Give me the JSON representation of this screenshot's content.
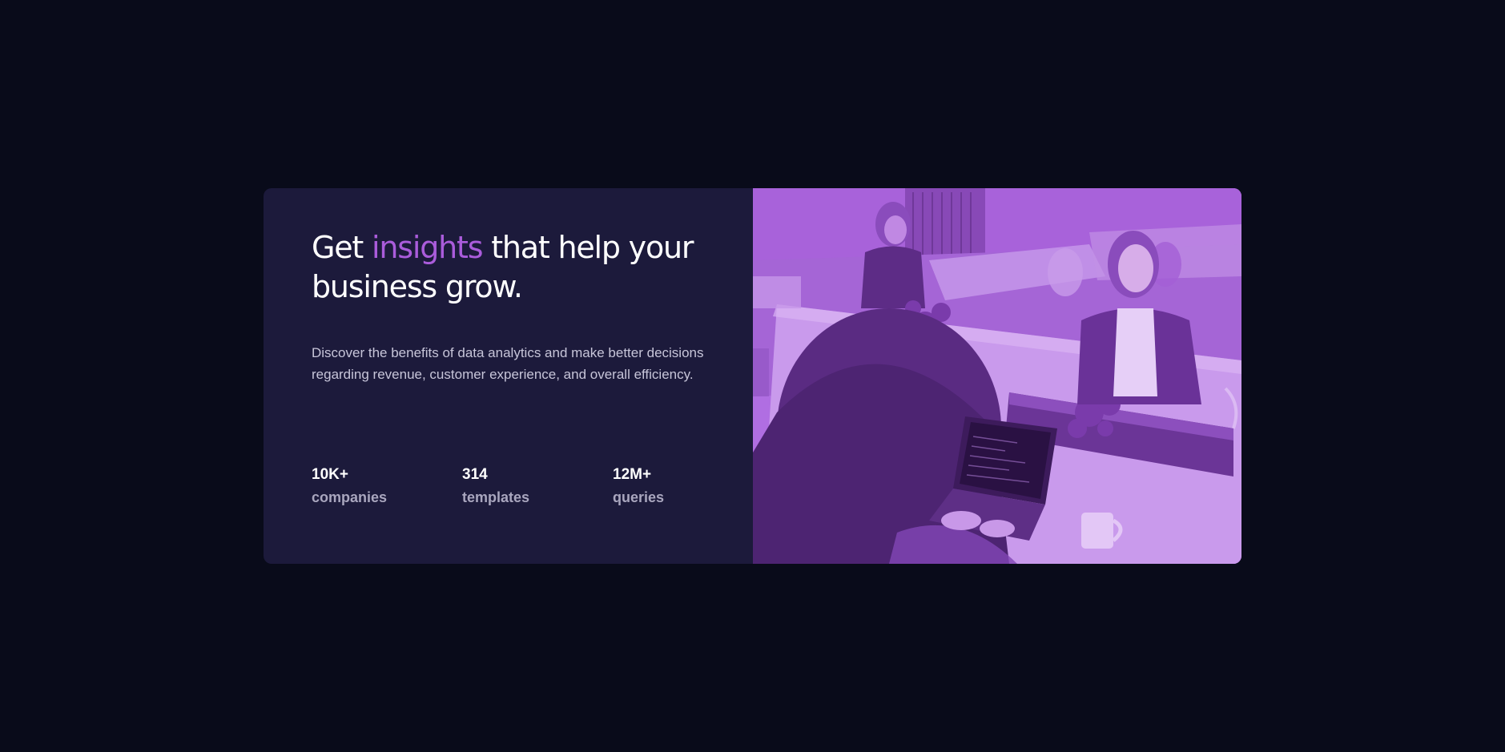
{
  "card": {
    "headline": {
      "before": "Get ",
      "accent": "insights",
      "after": " that help your business grow."
    },
    "description": "Discover the benefits of data analytics and make better decisions regarding revenue, customer experience, and overall efficiency.",
    "stats": [
      {
        "value": "10K+",
        "label": "companies"
      },
      {
        "value": "314",
        "label": "templates"
      },
      {
        "value": "12M+",
        "label": "queries"
      }
    ]
  },
  "colors": {
    "page_background": "#090b1a",
    "card_background": "#1c1a3b",
    "accent": "#aa5cdb",
    "image_overlay": "#b16ee3"
  },
  "image": {
    "icon": "office-photo-purple-overlay"
  }
}
